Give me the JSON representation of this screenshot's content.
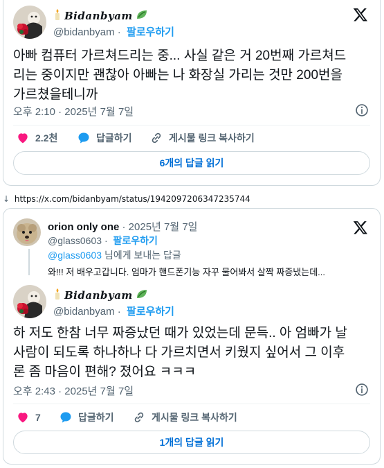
{
  "tweet1": {
    "display_name": "Bidanbyam",
    "handle": "@bidanbyam",
    "follow_label": "팔로우하기",
    "text_lines": [
      "아빠 컴퓨터 가르쳐드리는 중... 사실 같은 거 20번째 가르쳐드",
      "리는 중이지만 괜찮아 아빠는 나 화장실 가리는 것만 200번을",
      "가르쳤을테니까"
    ],
    "timestamp": "오후 2:10 · 2025년 7월 7일",
    "like_count": "2.2천",
    "reply_label": "답글하기",
    "copy_link_label": "게시물 링크 복사하기",
    "read_replies_label": "6개의 답글 읽기"
  },
  "url_bar": {
    "arrow": "↓",
    "url": "https://x.com/bidanbyam/status/1942097206347235744"
  },
  "tweet2": {
    "parent": {
      "display_name": "orion only one",
      "date": "· 2025년 7월 7일",
      "handle": "@glass0603",
      "follow_label": "팔로우하기",
      "replying_to": "님에게 보내는 답글",
      "text": "와!!! 저 배우고갑니다. 엄마가 핸드폰기능 자꾸 물어봐서 살짝 짜증냈는데..."
    },
    "display_name": "Bidanbyam",
    "handle": "@bidanbyam",
    "follow_label": "팔로우하기",
    "text_lines": [
      "하 저도 한참 너무 짜증났던 때가 있었는데 문득.. 아 엄빠가 날",
      "사람이 되도록 하나하나 다 가르치면서 키웠지 싶어서 그 이후",
      "론 좀 마음이 편해? 졌어요 ㅋㅋㅋ"
    ],
    "timestamp": "오후 2:43 · 2025년 7월 7일",
    "like_count": "7",
    "reply_label": "답글하기",
    "copy_link_label": "게시물 링크 복사하기",
    "read_replies_label": "1개의 답글 읽기"
  },
  "colors": {
    "like_heart": "#f91880",
    "reply_bubble": "#1d9bf0",
    "link_blue": "#006fd6",
    "follow_blue": "#1d9bf0",
    "secondary_text": "#536471",
    "border": "#cfd9de"
  },
  "icons": {
    "x_logo": "x-logo-icon",
    "info": "info-icon",
    "heart": "heart-icon",
    "reply": "reply-bubble-icon",
    "link": "link-icon",
    "candle": "candle-emoji-icon",
    "leaf": "leaf-emoji-icon"
  }
}
